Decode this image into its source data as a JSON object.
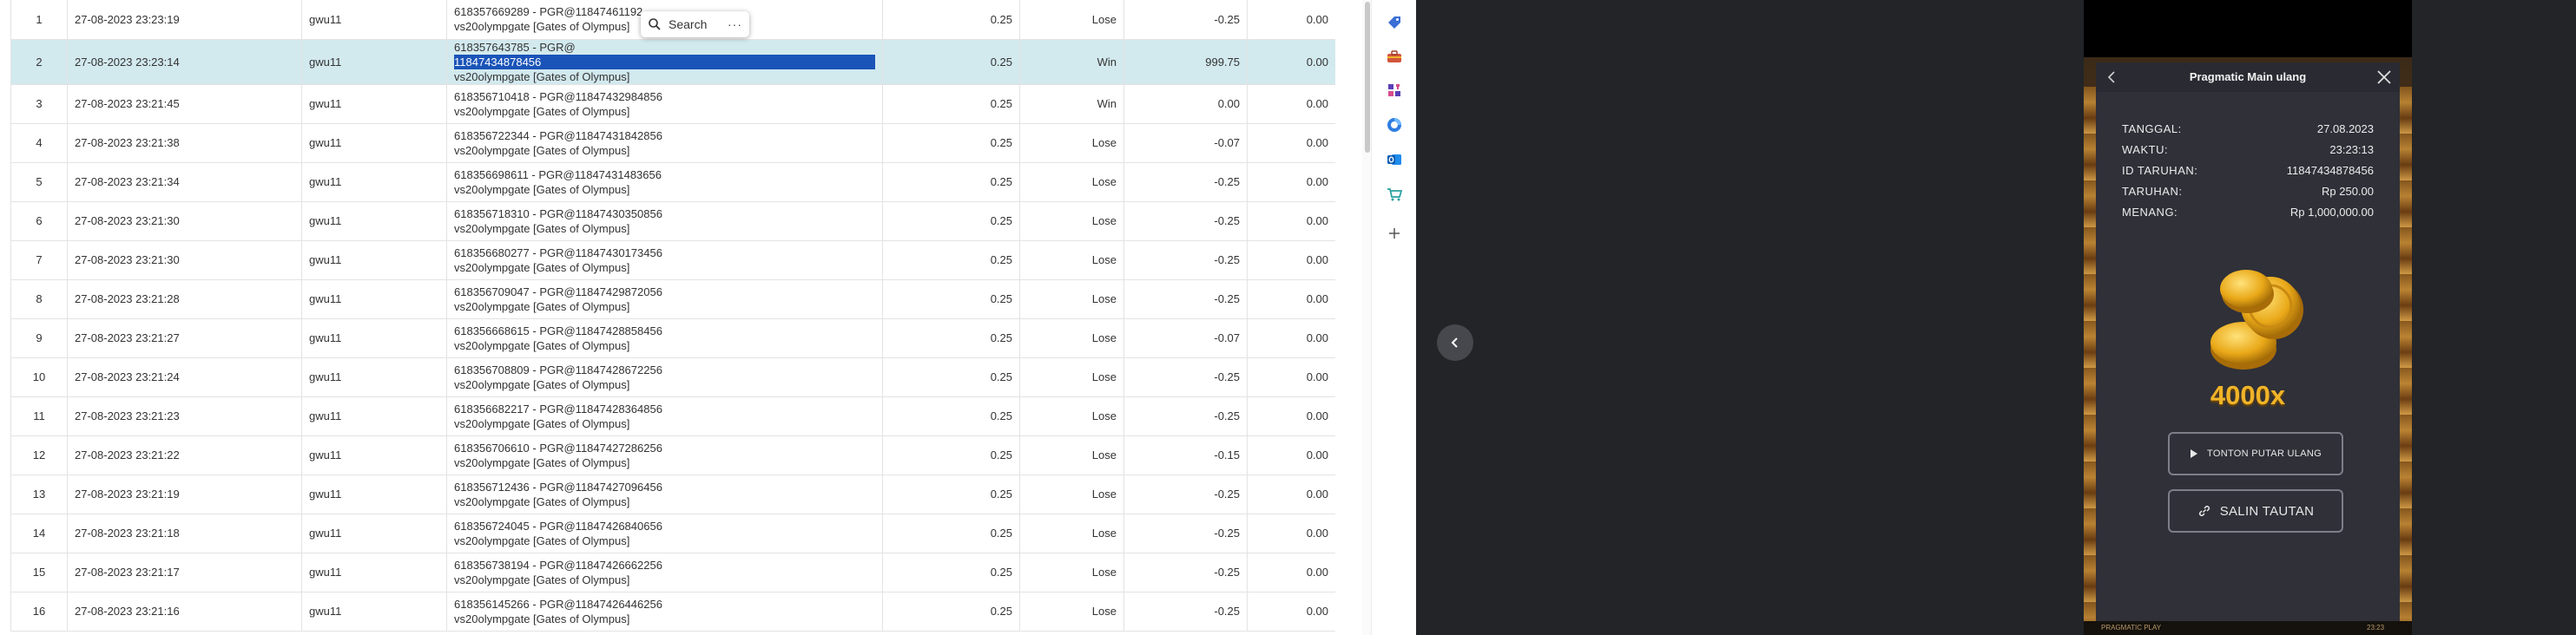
{
  "table": {
    "rows": [
      {
        "no": "1",
        "time": "27-08-2023 23:23:19",
        "user": "gwu11",
        "ref1": "618357669289 - PGR@11847461192",
        "ref2": "vs20olympgate [Gates of Olympus]",
        "bet": "0.25",
        "result": "Lose",
        "amount": "-0.25",
        "bal": "0.00"
      },
      {
        "no": "2",
        "time": "27-08-2023 23:23:14",
        "user": "gwu11",
        "ref1_pre": "618357643785 - PGR@",
        "ref1_hl": "11847434878456",
        "ref2": "vs20olympgate [Gates of Olympus]",
        "bet": "0.25",
        "result": "Win",
        "amount": "999.75",
        "bal": "0.00"
      },
      {
        "no": "3",
        "time": "27-08-2023 23:21:45",
        "user": "gwu11",
        "ref1": "618356710418 - PGR@11847432984856",
        "ref2": "vs20olympgate [Gates of Olympus]",
        "bet": "0.25",
        "result": "Win",
        "amount": "0.00",
        "bal": "0.00"
      },
      {
        "no": "4",
        "time": "27-08-2023 23:21:38",
        "user": "gwu11",
        "ref1": "618356722344 - PGR@11847431842856",
        "ref2": "vs20olympgate [Gates of Olympus]",
        "bet": "0.25",
        "result": "Lose",
        "amount": "-0.07",
        "bal": "0.00"
      },
      {
        "no": "5",
        "time": "27-08-2023 23:21:34",
        "user": "gwu11",
        "ref1": "618356698611 - PGR@11847431483656",
        "ref2": "vs20olympgate [Gates of Olympus]",
        "bet": "0.25",
        "result": "Lose",
        "amount": "-0.25",
        "bal": "0.00"
      },
      {
        "no": "6",
        "time": "27-08-2023 23:21:30",
        "user": "gwu11",
        "ref1": "618356718310 - PGR@11847430350856",
        "ref2": "vs20olympgate [Gates of Olympus]",
        "bet": "0.25",
        "result": "Lose",
        "amount": "-0.25",
        "bal": "0.00"
      },
      {
        "no": "7",
        "time": "27-08-2023 23:21:30",
        "user": "gwu11",
        "ref1": "618356680277 - PGR@11847430173456",
        "ref2": "vs20olympgate [Gates of Olympus]",
        "bet": "0.25",
        "result": "Lose",
        "amount": "-0.25",
        "bal": "0.00"
      },
      {
        "no": "8",
        "time": "27-08-2023 23:21:28",
        "user": "gwu11",
        "ref1": "618356709047 - PGR@11847429872056",
        "ref2": "vs20olympgate [Gates of Olympus]",
        "bet": "0.25",
        "result": "Lose",
        "amount": "-0.25",
        "bal": "0.00"
      },
      {
        "no": "9",
        "time": "27-08-2023 23:21:27",
        "user": "gwu11",
        "ref1": "618356668615 - PGR@11847428858456",
        "ref2": "vs20olympgate [Gates of Olympus]",
        "bet": "0.25",
        "result": "Lose",
        "amount": "-0.07",
        "bal": "0.00"
      },
      {
        "no": "10",
        "time": "27-08-2023 23:21:24",
        "user": "gwu11",
        "ref1": "618356708809 - PGR@11847428672256",
        "ref2": "vs20olympgate [Gates of Olympus]",
        "bet": "0.25",
        "result": "Lose",
        "amount": "-0.25",
        "bal": "0.00"
      },
      {
        "no": "11",
        "time": "27-08-2023 23:21:23",
        "user": "gwu11",
        "ref1": "618356682217 - PGR@11847428364856",
        "ref2": "vs20olympgate [Gates of Olympus]",
        "bet": "0.25",
        "result": "Lose",
        "amount": "-0.25",
        "bal": "0.00"
      },
      {
        "no": "12",
        "time": "27-08-2023 23:21:22",
        "user": "gwu11",
        "ref1": "618356706610 - PGR@11847427286256",
        "ref2": "vs20olympgate [Gates of Olympus]",
        "bet": "0.25",
        "result": "Lose",
        "amount": "-0.15",
        "bal": "0.00"
      },
      {
        "no": "13",
        "time": "27-08-2023 23:21:19",
        "user": "gwu11",
        "ref1": "618356712436 - PGR@11847427096456",
        "ref2": "vs20olympgate [Gates of Olympus]",
        "bet": "0.25",
        "result": "Lose",
        "amount": "-0.25",
        "bal": "0.00"
      },
      {
        "no": "14",
        "time": "27-08-2023 23:21:18",
        "user": "gwu11",
        "ref1": "618356724045 - PGR@11847426840656",
        "ref2": "vs20olympgate [Gates of Olympus]",
        "bet": "0.25",
        "result": "Lose",
        "amount": "-0.25",
        "bal": "0.00"
      },
      {
        "no": "15",
        "time": "27-08-2023 23:21:17",
        "user": "gwu11",
        "ref1": "618356738194 - PGR@11847426662256",
        "ref2": "vs20olympgate [Gates of Olympus]",
        "bet": "0.25",
        "result": "Lose",
        "amount": "-0.25",
        "bal": "0.00"
      },
      {
        "no": "16",
        "time": "27-08-2023 23:21:16",
        "user": "gwu11",
        "ref1": "618356145266 - PGR@11847426446256",
        "ref2": "vs20olympgate [Gates of Olympus]",
        "bet": "0.25",
        "result": "Lose",
        "amount": "-0.25",
        "bal": "0.00"
      }
    ]
  },
  "search_popup": {
    "label": "Search",
    "icon": "search-icon",
    "more": "···"
  },
  "sidebar_icons": [
    "tag-icon",
    "toolbox-icon",
    "chess-icon",
    "circle-app-icon",
    "outlook-icon",
    "cart-icon",
    "plus-icon"
  ],
  "viewer": {
    "prev_icon": "chevron-left-icon",
    "modal": {
      "title": "Pragmatic Main ulang",
      "info": [
        {
          "key": "TANGGAL:",
          "value": "27.08.2023"
        },
        {
          "key": "WAKTU:",
          "value": "23:23:13"
        },
        {
          "key": "ID TARUHAN:",
          "value": "11847434878456"
        },
        {
          "key": "TARUHAN:",
          "value": "Rp 250.00"
        },
        {
          "key": "MENANG:",
          "value": "Rp 1,000,000.00"
        }
      ],
      "multiplier": "4000x",
      "replay_label": "TONTON PUTAR ULANG",
      "copy_label": "SALIN TAUTAN"
    },
    "footer_brand": "PRAGMATIC PLAY",
    "footer_time": "23:23"
  },
  "colors": {
    "lose": "#e53935",
    "win": "#2e9e44",
    "selected_row": "#d2e9ee",
    "highlight": "#1a54b8",
    "gold": "#f0b429"
  }
}
